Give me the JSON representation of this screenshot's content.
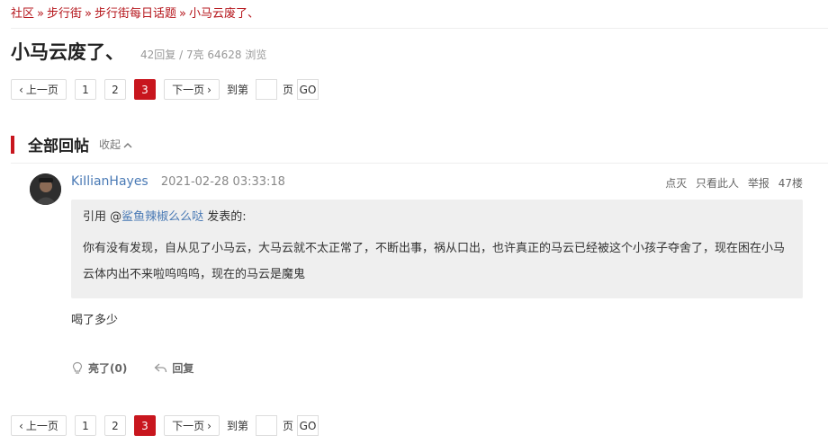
{
  "breadcrumb": [
    "社区",
    "步行街",
    "步行街每日话题",
    "小马云废了、"
  ],
  "breadcrumb_sep": "»",
  "thread": {
    "title": "小马云废了、",
    "stats": "42回复 / 7亮 64628 浏览"
  },
  "pager": {
    "prev": "上一页",
    "pages": [
      "1",
      "2",
      "3"
    ],
    "current": "3",
    "next": "下一页",
    "goto_label": "到第",
    "page_label": "页",
    "go": "GO"
  },
  "section": {
    "title": "全部回帖",
    "collapse": "收起"
  },
  "post": {
    "author": "KiIlianHayes",
    "time": "2021-02-28 03:33:18",
    "actions": [
      "点灭",
      "只看此人",
      "举报"
    ],
    "floor": "47楼",
    "quote": {
      "prefix": "引用 @",
      "user": "鲨鱼辣椒么么哒",
      "suffix": "发表的:",
      "body": "你有没有发现，自从见了小马云，大马云就不太正常了，不断出事，祸从口出，也许真正的马云已经被这个小孩子夺舍了，现在困在小马云体内出不来啦呜呜呜，现在的马云是魔鬼"
    },
    "content": "喝了多少",
    "light_label": "亮了(0)",
    "reply_label": "回复"
  },
  "colors": {
    "accent": "#c8161e",
    "link": "#4a7ab5",
    "quote_bg": "#efefef"
  }
}
